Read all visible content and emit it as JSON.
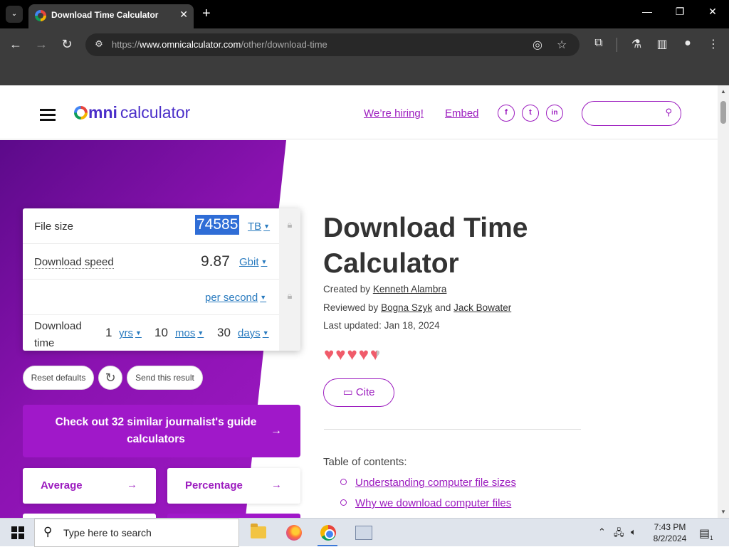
{
  "browser": {
    "tab_title": "Download Time Calculator",
    "url_prefix": "https://",
    "url_domain": "www.omnicalculator.com",
    "url_path": "/other/download-time"
  },
  "header": {
    "logo_mni": "mni",
    "logo_calc": "calculator",
    "hiring_link": "We’re hiring!",
    "embed_link": "Embed",
    "social": [
      "f",
      "t",
      "in"
    ],
    "search_placeholder": ""
  },
  "calculator": {
    "file_size_label": "File size",
    "file_size_value": "74585",
    "file_size_unit": "TB",
    "download_speed_label": "Download speed",
    "download_speed_value": "9.87",
    "download_speed_unit": "Gbit",
    "per_unit": "per second",
    "download_time_label": "Download time",
    "time_years": "1",
    "time_years_unit": "yrs",
    "time_months": "10",
    "time_months_unit": "mos",
    "time_days": "30",
    "time_days_unit": "days"
  },
  "actions": {
    "reset": "Reset defaults",
    "reload_icon": "↻",
    "send": "Send this result"
  },
  "similar": {
    "text": "Check out 32 similar journalist's guide calculators",
    "arrow": "→"
  },
  "related": [
    {
      "label": "Average",
      "arrow": "→"
    },
    {
      "label": "Percentage",
      "arrow": "→"
    }
  ],
  "article": {
    "title": "Download Time Calculator",
    "created_prefix": "Created by",
    "created_by": "Kenneth Alambra",
    "reviewed_prefix": "Reviewed by",
    "reviewer_1": "Bogna Szyk",
    "and": "and",
    "reviewer_2": "Jack Bowater",
    "updated": "Last updated: Jan 18, 2024",
    "rating": 4.5,
    "cite": "Cite",
    "toc_head": "Table of contents:",
    "toc": [
      "Understanding computer file sizes",
      "Why we download computer files"
    ]
  },
  "taskbar": {
    "search_placeholder": "Type here to search",
    "time": "7:43 PM",
    "date": "8/2/2024",
    "notification_count": "1"
  },
  "colors": {
    "brand_purple": "#9c1cbf",
    "selection": "#2f6dd6",
    "heart": "#f05b6a"
  }
}
